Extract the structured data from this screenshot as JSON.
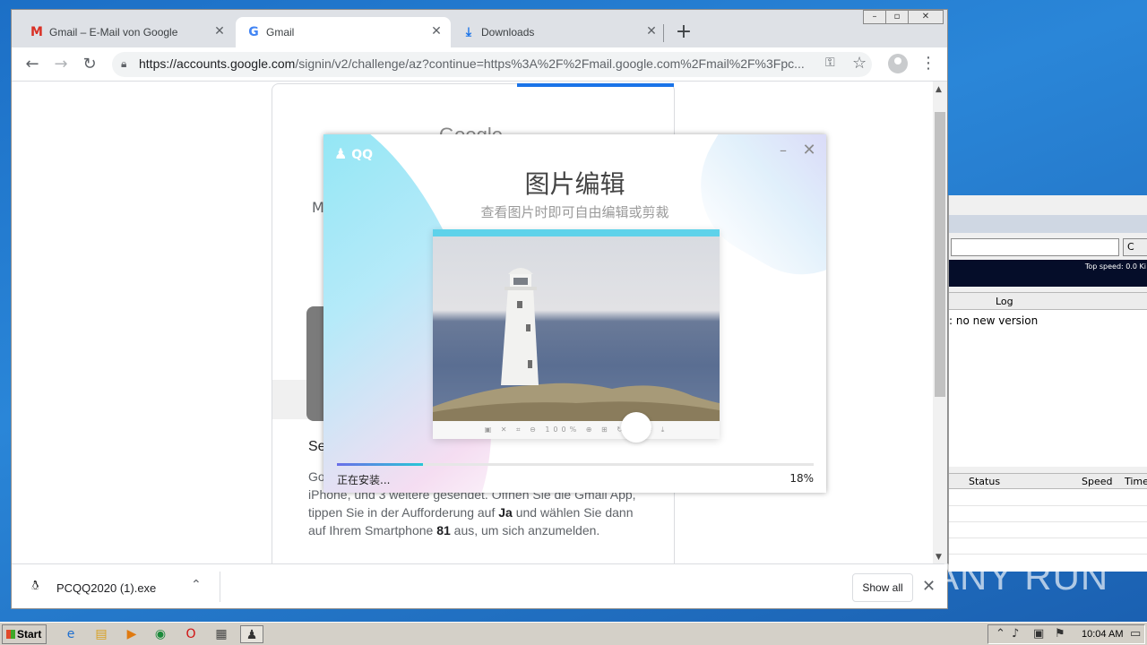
{
  "browser": {
    "tabs": [
      {
        "title": "Gmail – E-Mail von Google",
        "icon": "gmail-icon"
      },
      {
        "title": "Gmail",
        "icon": "google-g-icon"
      },
      {
        "title": "Downloads",
        "icon": "download-icon"
      }
    ],
    "new_tab": "+",
    "url_host": "https://accounts.google.com",
    "url_rest": "/signin/v2/challenge/az?continue=https%3A%2F%2Fmail.google.com%2Fmail%2F%3Fpc..."
  },
  "google_card": {
    "logo": "Google",
    "heading_initial": "M",
    "section_title": "Se",
    "paragraph_lines": [
      "Go",
      "iPhone, und 3 weitere gesendet. Öffnen Sie die Gmail App,",
      "tippen Sie in der Aufforderung auf",
      "Ja",
      "und wählen Sie dann",
      "auf Ihrem Smartphone",
      "81",
      "aus, um sich anzumelden."
    ]
  },
  "download_bar": {
    "filename": "PCQQ2020 (1).exe",
    "show_all": "Show all"
  },
  "qq_installer": {
    "logo": "QQ",
    "title": "图片编辑",
    "subtitle": "查看图片时即可自由编辑或剪裁",
    "status": "正在安装...",
    "percent_label": "18%",
    "progress": 0.18,
    "preview_tools": "▣ ✕ ⌗ ⊖ 100% ⊕ ⊞ ↻ ✎ ⌗ ⤓"
  },
  "background_app": {
    "button_c": "C",
    "top_speed": "Top speed: 0.0 Ki",
    "log_header": "Log",
    "log_line": ": no new version",
    "columns": [
      "Status",
      "Speed",
      "Time"
    ]
  },
  "watermark": "ANY RUN",
  "taskbar": {
    "start": "Start",
    "clock": "10:04 AM"
  },
  "colors": {
    "accent_blue": "#1a73e8",
    "qq_cyan": "#27c7d6",
    "desktop_blue": "#2a86d8"
  }
}
